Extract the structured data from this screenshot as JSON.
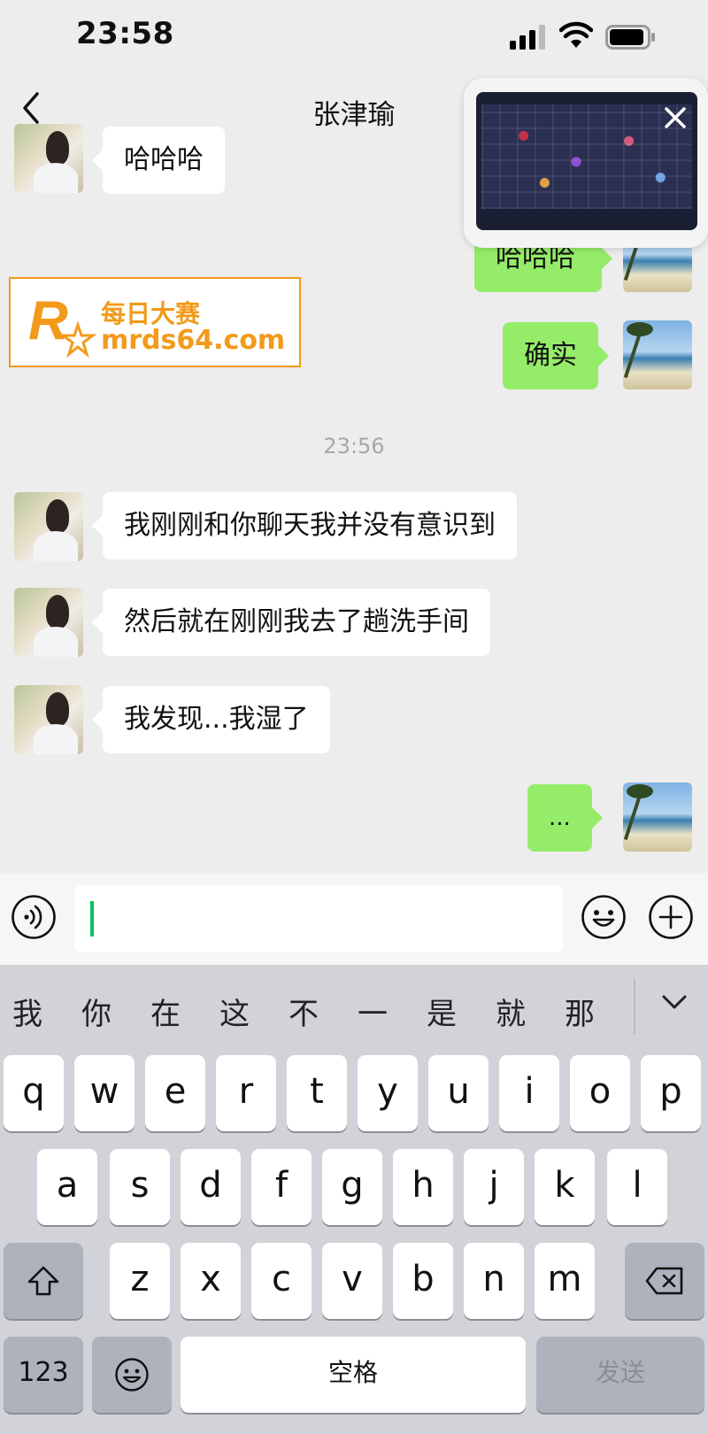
{
  "status_bar": {
    "time": "23:58"
  },
  "header": {
    "title": "张津瑜"
  },
  "watermark": {
    "line1": "每日大赛",
    "line2": "mrds64.com",
    "logo_text": "R 每日大赛"
  },
  "chat": {
    "messages_top": [
      {
        "side": "in",
        "text": "哈哈哈"
      },
      {
        "side": "out",
        "text": "哈哈哈"
      },
      {
        "side": "out",
        "text": "确实"
      }
    ],
    "timestamp": "23:56",
    "messages_bottom": [
      {
        "side": "in",
        "text": "我刚刚和你聊天我并没有意识到"
      },
      {
        "side": "in",
        "text": "然后就在刚刚我去了趟洗手间"
      },
      {
        "side": "in",
        "text": "我发现...我湿了"
      },
      {
        "side": "out",
        "text": "..."
      }
    ]
  },
  "input_bar": {
    "value": ""
  },
  "keyboard": {
    "candidates": [
      "我",
      "你",
      "在",
      "这",
      "不",
      "一",
      "是",
      "就",
      "那"
    ],
    "row1": [
      "q",
      "w",
      "e",
      "r",
      "t",
      "y",
      "u",
      "i",
      "o",
      "p"
    ],
    "row2": [
      "a",
      "s",
      "d",
      "f",
      "g",
      "h",
      "j",
      "k",
      "l"
    ],
    "row3": [
      "z",
      "x",
      "c",
      "v",
      "b",
      "n",
      "m"
    ],
    "numbers_label": "123",
    "space_label": "空格",
    "send_label": "发送"
  },
  "icons": {
    "back": "chevron-left-icon",
    "pip_close": "close-icon",
    "voice": "voice-icon",
    "emoji": "emoji-icon",
    "plus": "plus-icon",
    "shift": "shift-icon",
    "delete": "backspace-icon",
    "collapse": "chevron-down-icon"
  },
  "colors": {
    "outgoing_bubble": "#95ec69",
    "incoming_bubble": "#ffffff",
    "caret": "#07c160",
    "watermark": "#f29a1a",
    "background": "#ededed"
  }
}
